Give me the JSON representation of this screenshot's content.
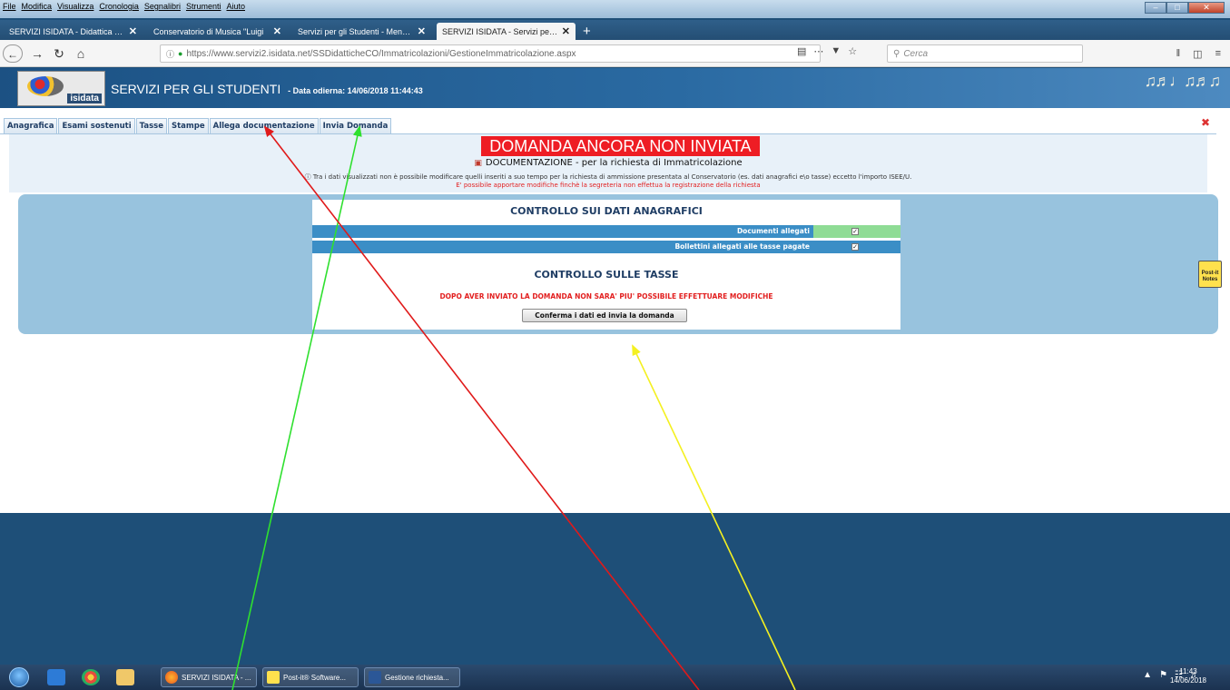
{
  "menubar": [
    "File",
    "Modifica",
    "Visualizza",
    "Cronologia",
    "Segnalibri",
    "Strumenti",
    "Aiuto"
  ],
  "browser_tabs": [
    {
      "label": "SERVIZI ISIDATA - Didattica Conser",
      "active": false
    },
    {
      "label": "Conservatorio di Musica \"Luigi",
      "active": false
    },
    {
      "label": "Servizi per gli Studenti - Menu princ",
      "active": false
    },
    {
      "label": "SERVIZI ISIDATA - Servizi per gli stu",
      "active": true
    }
  ],
  "new_tab_label": "+",
  "url": "https://www.servizi2.isidata.net/SSDidatticheCO/Immatricolazioni/GestioneImmatricolazione.aspx",
  "search_placeholder": "Cerca",
  "banner": {
    "logo_text": "isidata",
    "title": "SERVIZI PER GLI STUDENTI",
    "date": "- Data odierna: 14/06/2018 11:44:43"
  },
  "app_tabs": [
    "Anagrafica",
    "Esami sostenuti",
    "Tasse",
    "Stampe",
    "Allega documentazione",
    "Invia Domanda"
  ],
  "status_banner": "DOMANDA ANCORA NON INVIATA",
  "doc_title": "DOCUMENTAZIONE - per la richiesta di Immatricolazione",
  "doc_info": "Tra i dati visualizzati non è possibile modificare quelli inseriti a suo tempo per la richiesta di ammissione presentata al Conservatorio (es. dati anagrafici e\\o tasse) eccetto l'importo ISEE/U.",
  "doc_warning": "E' possibile apportare modifiche finchè la segreteria non effettua la registrazione della richiesta",
  "anagrafica_title": "CONTROLLO SUI DATI ANAGRAFICI",
  "check_rows": [
    {
      "label": "Documenti allegati",
      "checked": true
    },
    {
      "label": "Bollettini allegati alle tasse pagate",
      "checked": true
    }
  ],
  "tasse_title": "CONTROLLO SULLE TASSE",
  "final_warning": "DOPO AVER INVIATO LA DOMANDA NON SARA' PIU' POSSIBILE EFFETTUARE MODIFICHE",
  "confirm_button": "Conferma i dati ed invia la domanda",
  "postit_label": "Post-it Notes",
  "taskbar": {
    "tasks": [
      "SERVIZI ISIDATA - ...",
      "Post-it® Software...",
      "Gestione richiesta..."
    ],
    "time": "11:43",
    "date": "14/06/2018"
  },
  "colors": {
    "status_banner_bg": "#ee1d24",
    "arrow_red": "#e01a1a",
    "arrow_green": "#2fe02f",
    "arrow_yellow": "#f4f020"
  }
}
